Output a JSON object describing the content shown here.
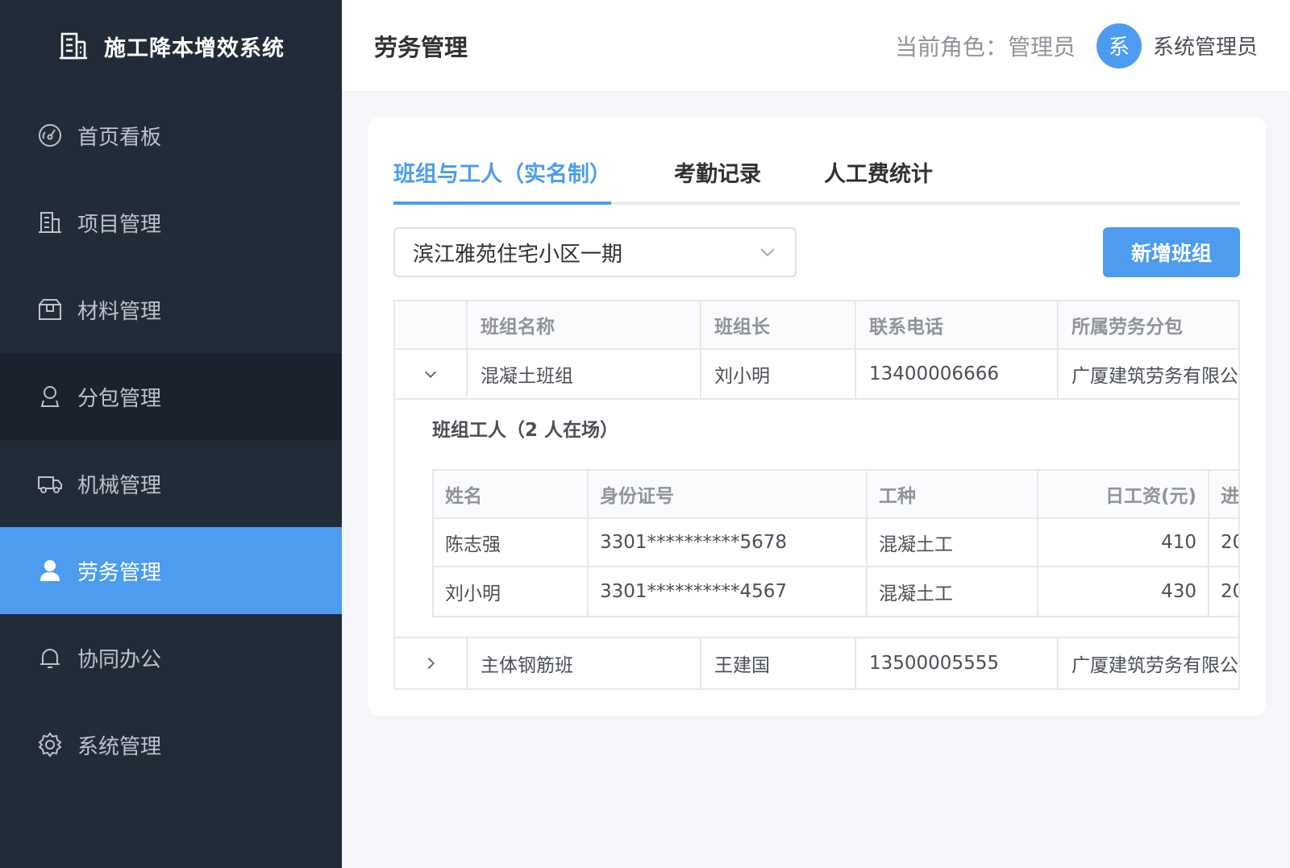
{
  "app": {
    "title": "施工降本增效系统"
  },
  "sidebar": {
    "items": [
      {
        "label": "首页看板",
        "icon": "dashboard-icon"
      },
      {
        "label": "项目管理",
        "icon": "building-icon"
      },
      {
        "label": "材料管理",
        "icon": "box-icon"
      },
      {
        "label": "分包管理",
        "icon": "user-outline-icon"
      },
      {
        "label": "机械管理",
        "icon": "truck-icon"
      },
      {
        "label": "劳务管理",
        "icon": "user-icon"
      },
      {
        "label": "协同办公",
        "icon": "bell-icon"
      },
      {
        "label": "系统管理",
        "icon": "gear-icon"
      }
    ],
    "active_index": 5
  },
  "header": {
    "page_title": "劳务管理",
    "role_text": "当前角色：管理员",
    "avatar_char": "系",
    "user_name": "系统管理员"
  },
  "tabs": [
    {
      "label": "班组与工人（实名制）",
      "active": true
    },
    {
      "label": "考勤记录",
      "active": false
    },
    {
      "label": "人工费统计",
      "active": false
    }
  ],
  "toolbar": {
    "project_select_value": "滨江雅苑住宅小区一期",
    "add_button_label": "新增班组"
  },
  "team_table": {
    "headers": [
      "班组名称",
      "班组长",
      "联系电话",
      "所属劳务分包"
    ],
    "rows": [
      {
        "name": "混凝土班组",
        "leader": "刘小明",
        "phone": "13400006666",
        "subcontractor": "广厦建筑劳务有限公",
        "expanded": true
      },
      {
        "name": "主体钢筋班",
        "leader": "王建国",
        "phone": "13500005555",
        "subcontractor": "广厦建筑劳务有限公",
        "expanded": false
      }
    ]
  },
  "workers": {
    "title": "班组工人（2 人在场）",
    "headers": [
      "姓名",
      "身份证号",
      "工种",
      "日工资(元)",
      "进"
    ],
    "rows": [
      {
        "name": "陈志强",
        "id": "3301**********5678",
        "type": "混凝土工",
        "wage": "410",
        "more": "20"
      },
      {
        "name": "刘小明",
        "id": "3301**********4567",
        "type": "混凝土工",
        "wage": "430",
        "more": "20"
      }
    ]
  },
  "colors": {
    "accent": "#4d9cf0",
    "sidebar_bg": "#222b38"
  }
}
